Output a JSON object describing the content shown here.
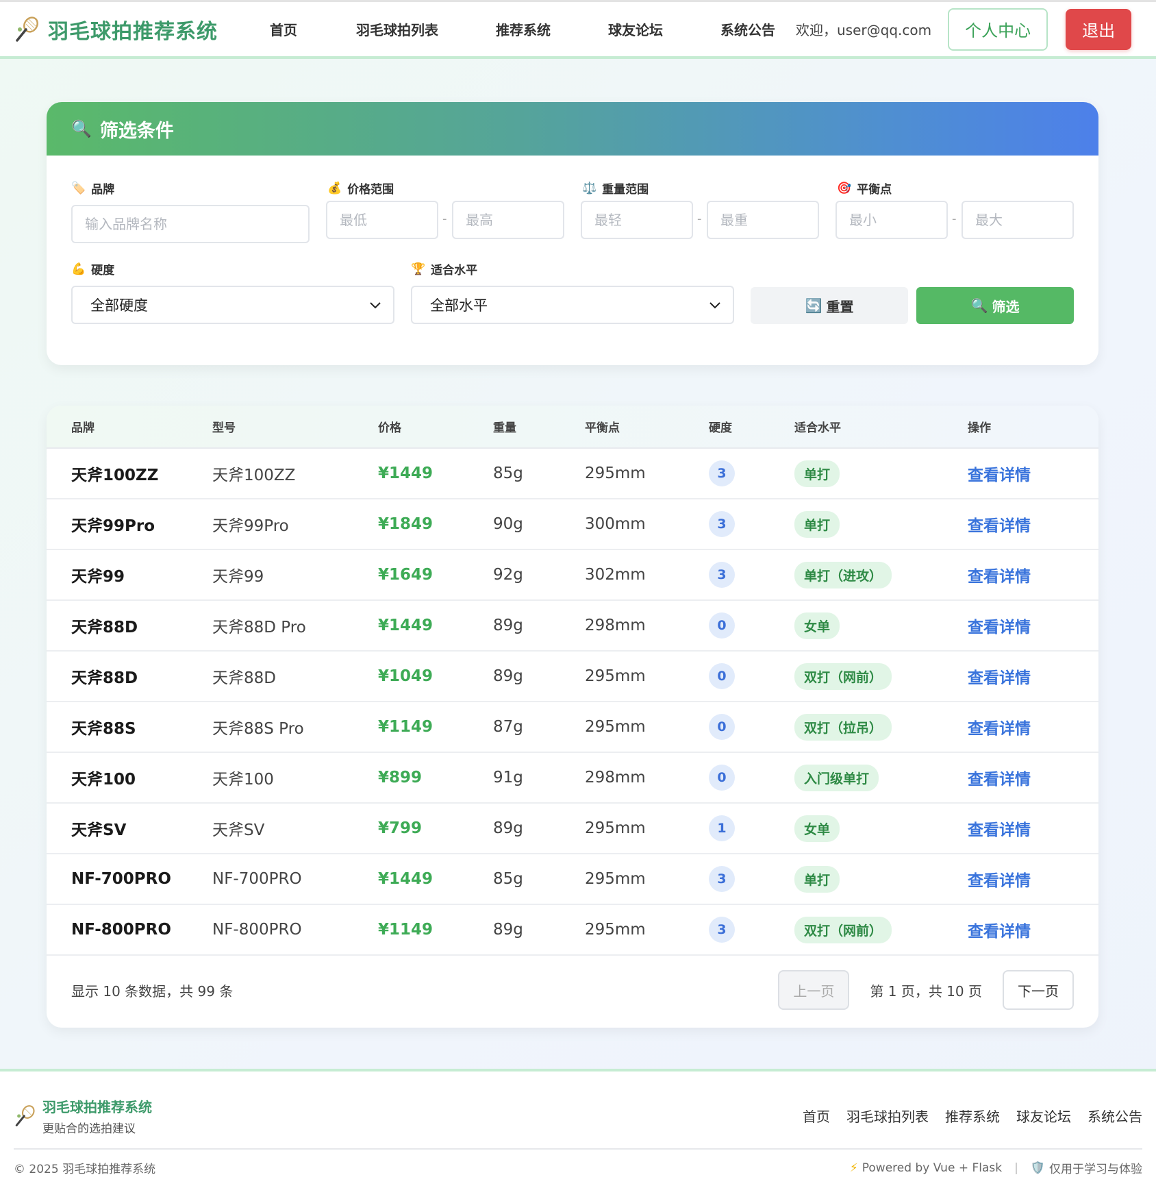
{
  "header": {
    "app_title": "羽毛球拍推荐系统",
    "nav": [
      "首页",
      "羽毛球拍列表",
      "推荐系统",
      "球友论坛",
      "系统公告"
    ],
    "welcome": "欢迎，user@qq.com",
    "profile_label": "个人中心",
    "logout_label": "退出"
  },
  "filter": {
    "title": "筛选条件",
    "brand_label": "品牌",
    "brand_placeholder": "输入品牌名称",
    "price_label": "价格范围",
    "price_min_placeholder": "最低",
    "price_max_placeholder": "最高",
    "weight_label": "重量范围",
    "weight_min_placeholder": "最轻",
    "weight_max_placeholder": "最重",
    "balance_label": "平衡点",
    "balance_min_placeholder": "最小",
    "balance_max_placeholder": "最大",
    "hardness_label": "硬度",
    "hardness_value": "全部硬度",
    "level_label": "适合水平",
    "level_value": "全部水平",
    "reset_label": "重置",
    "filter_label": "筛选",
    "dash": "-"
  },
  "table": {
    "headers": [
      "品牌",
      "型号",
      "价格",
      "重量",
      "平衡点",
      "硬度",
      "适合水平",
      "操作"
    ],
    "action_label": "查看详情",
    "rows": [
      {
        "brand": "天斧100ZZ",
        "model": "天斧100ZZ",
        "price": "¥1449",
        "weight": "85g",
        "balance": "295mm",
        "hardness": "3",
        "level": "单打"
      },
      {
        "brand": "天斧99Pro",
        "model": "天斧99Pro",
        "price": "¥1849",
        "weight": "90g",
        "balance": "300mm",
        "hardness": "3",
        "level": "单打"
      },
      {
        "brand": "天斧99",
        "model": "天斧99",
        "price": "¥1649",
        "weight": "92g",
        "balance": "302mm",
        "hardness": "3",
        "level": "单打（进攻）"
      },
      {
        "brand": "天斧88D",
        "model": "天斧88D Pro",
        "price": "¥1449",
        "weight": "89g",
        "balance": "298mm",
        "hardness": "0",
        "level": "女单"
      },
      {
        "brand": "天斧88D",
        "model": "天斧88D",
        "price": "¥1049",
        "weight": "89g",
        "balance": "295mm",
        "hardness": "0",
        "level": "双打（网前）"
      },
      {
        "brand": "天斧88S",
        "model": "天斧88S Pro",
        "price": "¥1149",
        "weight": "87g",
        "balance": "295mm",
        "hardness": "0",
        "level": "双打（拉吊）"
      },
      {
        "brand": "天斧100",
        "model": "天斧100",
        "price": "¥899",
        "weight": "91g",
        "balance": "298mm",
        "hardness": "0",
        "level": "入门级单打"
      },
      {
        "brand": "天斧SV",
        "model": "天斧SV",
        "price": "¥799",
        "weight": "89g",
        "balance": "295mm",
        "hardness": "1",
        "level": "女单"
      },
      {
        "brand": "NF-700PRO",
        "model": "NF-700PRO",
        "price": "¥1449",
        "weight": "85g",
        "balance": "295mm",
        "hardness": "3",
        "level": "单打"
      },
      {
        "brand": "NF-800PRO",
        "model": "NF-800PRO",
        "price": "¥1149",
        "weight": "89g",
        "balance": "295mm",
        "hardness": "3",
        "level": "双打（网前）"
      }
    ]
  },
  "pager": {
    "info": "显示 10 条数据，共 99 条",
    "prev_label": "上一页",
    "page_text": "第 1 页，共 10 页",
    "next_label": "下一页"
  },
  "footer": {
    "title": "羽毛球拍推荐系统",
    "subtitle": "更贴合的选拍建议",
    "nav": [
      "首页",
      "羽毛球拍列表",
      "推荐系统",
      "球友论坛",
      "系统公告"
    ],
    "copyright": "© 2025 羽毛球拍推荐系统",
    "powered": "Powered by Vue + Flask",
    "notice": "仅用于学习与体验",
    "sep": "|"
  },
  "colors": {
    "brand_green": "#3d9a6a",
    "price_green": "#3eab56",
    "link_blue": "#3a74dc",
    "logout_red": "#e0484a",
    "filter_button": "#55b965"
  },
  "icons": {
    "logo": "badminton-racket-icon",
    "filter_title": "magnifier-icon",
    "brand": "tag-icon",
    "price": "money-bag-icon",
    "weight": "scale-icon",
    "balance": "target-icon",
    "hardness": "muscle-icon",
    "level": "trophy-icon",
    "reset": "refresh-icon",
    "filter": "magnifier-icon",
    "powered": "lightning-icon",
    "notice": "shield-icon"
  }
}
